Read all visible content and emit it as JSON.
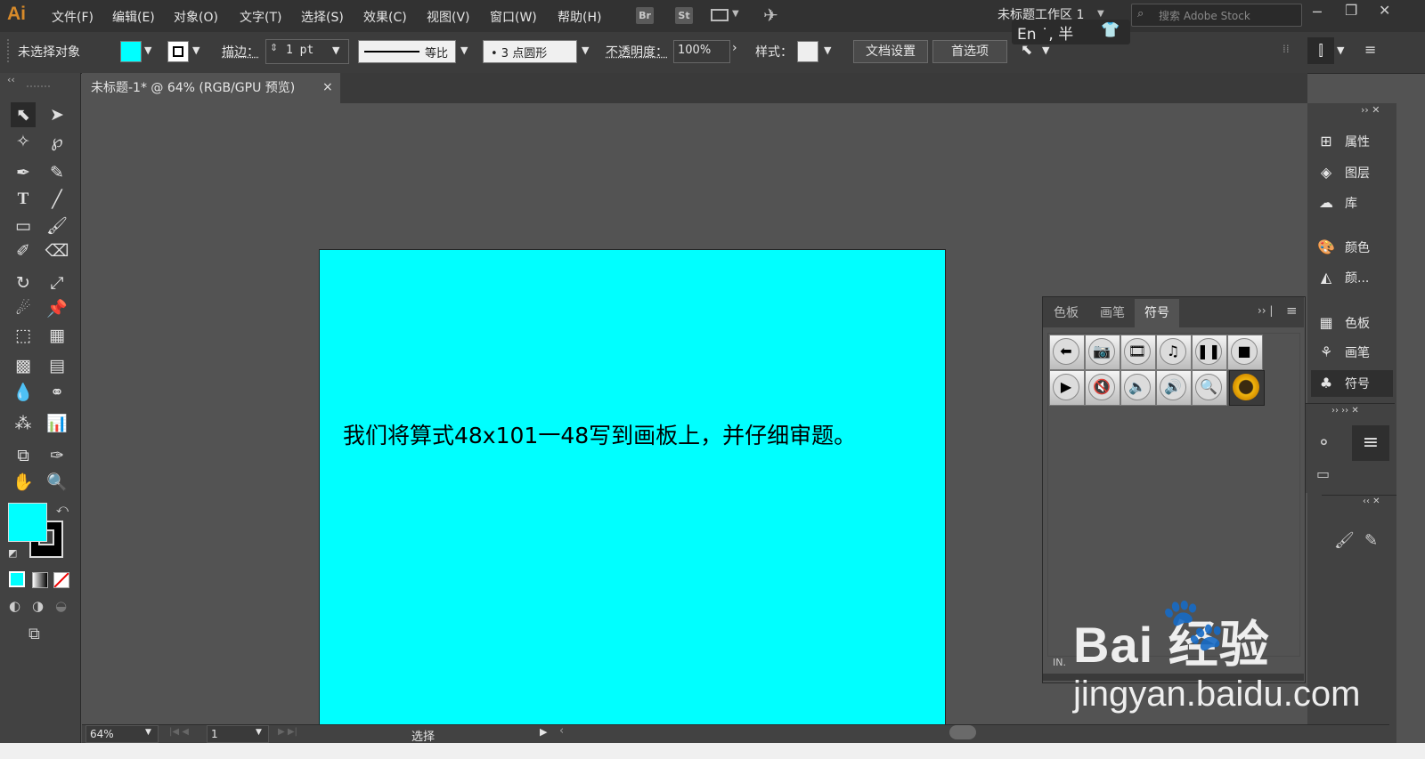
{
  "app": {
    "logo": "Ai"
  },
  "menu": [
    "文件(F)",
    "编辑(E)",
    "对象(O)",
    "文字(T)",
    "选择(S)",
    "效果(C)",
    "视图(V)",
    "窗口(W)",
    "帮助(H)"
  ],
  "app_icons": [
    "Br",
    "St"
  ],
  "workspace": {
    "label": "未标题工作区 1"
  },
  "stock_search": {
    "placeholder": "搜索 Adobe Stock"
  },
  "ime": {
    "text": "En ˙, 半"
  },
  "control": {
    "selection_status": "未选择对象",
    "stroke_label": "描边：",
    "stroke_value": "1 pt",
    "profile_label": "等比",
    "brush_label": "• 3 点圆形",
    "opacity_label": "不透明度：",
    "opacity_value": "100%",
    "style_label": "样式：",
    "doc_setup_button": "文档设置",
    "prefs_button": "首选项"
  },
  "document_tab": {
    "title": "未标题-1* @ 64% (RGB/GPU 预览)",
    "close": "×"
  },
  "canvas": {
    "text": "我们将算式48x101一48写到画板上，并仔细审题。",
    "fill_color": "#00ffff"
  },
  "status": {
    "zoom": "64%",
    "artboard": "1",
    "tool": "选择"
  },
  "dock": {
    "items": [
      {
        "label": "属性",
        "icon": "properties-icon"
      },
      {
        "label": "图层",
        "icon": "layers-icon"
      },
      {
        "label": "库",
        "icon": "libraries-icon"
      },
      {
        "label": "颜色",
        "icon": "color-icon"
      },
      {
        "label": "颜...",
        "icon": "color-guide-icon"
      },
      {
        "label": "色板",
        "icon": "swatches-icon"
      },
      {
        "label": "画笔",
        "icon": "brushes-icon"
      },
      {
        "label": "符号",
        "icon": "symbols-icon"
      }
    ]
  },
  "symbols_panel": {
    "tabs": [
      "色板",
      "画笔",
      "符号"
    ],
    "active_tab": "符号",
    "symbols": [
      "arrow-left-icon",
      "camera-icon",
      "film-icon",
      "music-icon",
      "pause-icon",
      "stop-icon",
      "play-icon",
      "mute-icon",
      "volume-low-icon",
      "volume-high-icon",
      "search-icon",
      "sunflower-icon"
    ]
  },
  "watermark": {
    "logo": "Bai  经验",
    "url": "jingyan.baidu.com"
  },
  "colors": {
    "fill": "#00ffff",
    "stroke": "#000000",
    "accent": "#d78a2a"
  }
}
